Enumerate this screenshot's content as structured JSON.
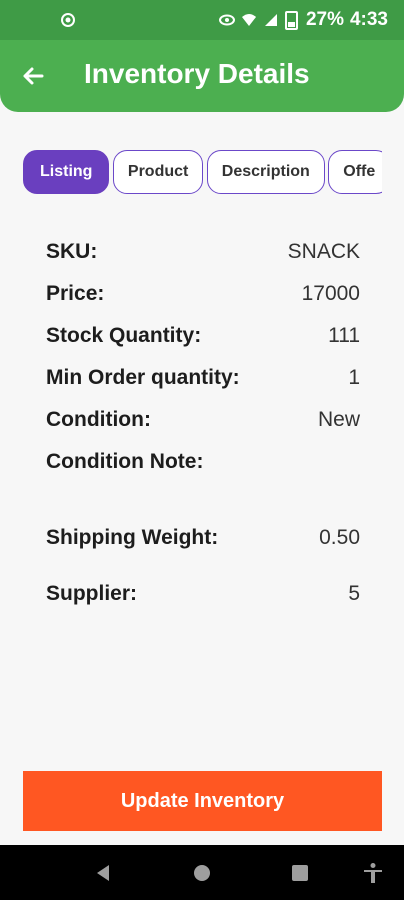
{
  "status_bar": {
    "battery": "27%",
    "time": "4:33",
    "network": "4G"
  },
  "header": {
    "title": "Inventory Details",
    "accent_color": "#4caf50"
  },
  "tabs": [
    {
      "label": "Listing",
      "active": true
    },
    {
      "label": "Product",
      "active": false
    },
    {
      "label": "Description",
      "active": false
    },
    {
      "label": "Offe",
      "active": false
    }
  ],
  "details": {
    "sku": {
      "label": "SKU:",
      "value": "SNACK"
    },
    "price": {
      "label": "Price:",
      "value": "17000"
    },
    "stock": {
      "label": "Stock Quantity:",
      "value": "111"
    },
    "min_order": {
      "label": "Min Order quantity:",
      "value": "1"
    },
    "condition": {
      "label": "Condition:",
      "value": "New"
    },
    "condition_note": {
      "label": "Condition Note:",
      "value": ""
    },
    "shipping_weight": {
      "label": "Shipping Weight:",
      "value": "0.50"
    },
    "supplier": {
      "label": "Supplier:",
      "value": "5"
    }
  },
  "actions": {
    "update_label": "Update Inventory",
    "update_color": "#ff5722"
  },
  "nav_bar": {
    "icons": [
      "back-triangle-icon",
      "home-circle-icon",
      "recents-square-icon",
      "accessibility-icon"
    ]
  }
}
